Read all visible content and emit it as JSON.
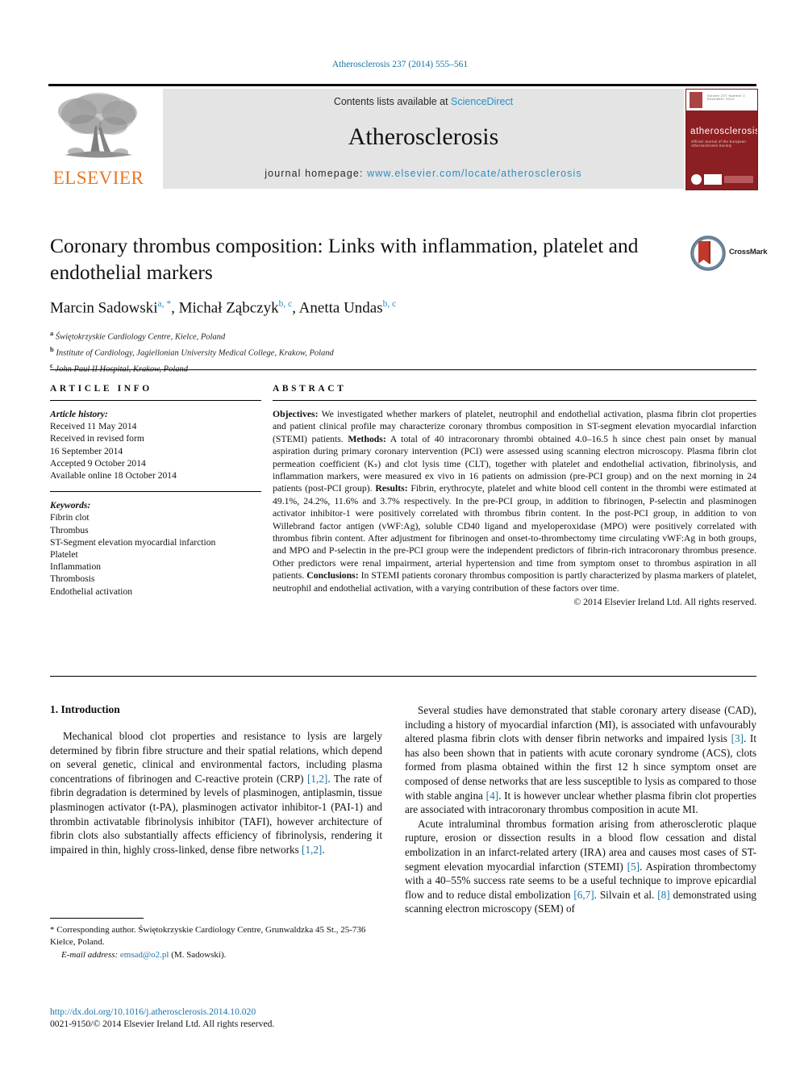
{
  "running_head": "Atherosclerosis 237 (2014) 555–561",
  "masthead": {
    "publisher": "ELSEVIER",
    "contents_prefix": "Contents lists available at ",
    "contents_link": "ScienceDirect",
    "journal_name": "Atherosclerosis",
    "homepage_prefix": "journal homepage: ",
    "homepage_url": "www.elsevier.com/locate/atherosclerosis",
    "cover": {
      "title": "atherosclerosis",
      "subtitle": "Official Journal of the European Atherosclerosis Society",
      "topline": "Volume 237  Number 2  December 2014"
    }
  },
  "article": {
    "title": "Coronary thrombus composition: Links with inflammation, platelet and endothelial markers",
    "authors": [
      {
        "name": "Marcin Sadowski",
        "marks": "a, *"
      },
      {
        "name": "Michał Ząbczyk",
        "marks": "b, c"
      },
      {
        "name": "Anetta Undas",
        "marks": "b, c"
      }
    ],
    "affiliations": [
      {
        "mark": "a",
        "text": "Świętokrzyskie Cardiology Centre, Kielce, Poland"
      },
      {
        "mark": "b",
        "text": "Institute of Cardiology, Jagiellonian University Medical College, Krakow, Poland"
      },
      {
        "mark": "c",
        "text": "John Paul II Hospital, Krakow, Poland"
      }
    ],
    "crossmark_label": "CrossMark"
  },
  "article_info": {
    "heading": "ARTICLE INFO",
    "history_label": "Article history:",
    "history": [
      "Received 11 May 2014",
      "Received in revised form",
      "16 September 2014",
      "Accepted 9 October 2014",
      "Available online 18 October 2014"
    ],
    "keywords_label": "Keywords:",
    "keywords": [
      "Fibrin clot",
      "Thrombus",
      "ST-Segment elevation myocardial infarction",
      "Platelet",
      "Inflammation",
      "Thrombosis",
      "Endothelial activation"
    ]
  },
  "abstract": {
    "heading": "ABSTRACT",
    "objectives_label": "Objectives:",
    "objectives_text": " We investigated whether markers of platelet, neutrophil and endothelial activation, plasma fibrin clot properties and patient clinical profile may characterize coronary thrombus composition in ST-segment elevation myocardial infarction (STEMI) patients. ",
    "methods_label": "Methods:",
    "methods_text": " A total of 40 intracoronary thrombi obtained 4.0–16.5 h since chest pain onset by manual aspiration during primary coronary intervention (PCI) were assessed using scanning electron microscopy. Plasma fibrin clot permeation coefficient (Kₛ) and clot lysis time (CLT), together with platelet and endothelial activation, fibrinolysis, and inflammation markers, were measured ex vivo in 16 patients on admission (pre-PCI group) and on the next morning in 24 patients (post-PCI group). ",
    "results_label": "Results:",
    "results_text": " Fibrin, erythrocyte, platelet and white blood cell content in the thrombi were estimated at 49.1%, 24.2%, 11.6% and 3.7% respectively. In the pre-PCI group, in addition to fibrinogen, P-selectin and plasminogen activator inhibitor-1 were positively correlated with thrombus fibrin content. In the post-PCI group, in addition to von Willebrand factor antigen (vWF:Ag), soluble CD40 ligand and myeloperoxidase (MPO) were positively correlated with thrombus fibrin content. After adjustment for fibrinogen and onset-to-thrombectomy time circulating vWF:Ag in both groups, and MPO and P-selectin in the pre-PCI group were the independent predictors of fibrin-rich intracoronary thrombus presence. Other predictors were renal impairment, arterial hypertension and time from symptom onset to thrombus aspiration in all patients. ",
    "conclusions_label": "Conclusions:",
    "conclusions_text": " In STEMI patients coronary thrombus composition is partly characterized by plasma markers of platelet, neutrophil and endothelial activation, with a varying contribution of these factors over time.",
    "copyright": "© 2014 Elsevier Ireland Ltd. All rights reserved."
  },
  "introduction": {
    "heading": "1. Introduction",
    "left_para_1a": "Mechanical blood clot properties and resistance to lysis are largely determined by fibrin fibre structure and their spatial relations, which depend on several genetic, clinical and environmental factors, including plasma concentrations of fibrinogen and C-reactive protein (CRP) ",
    "left_ref_1": "[1,2]",
    "left_para_1b": ". The rate of fibrin degradation is determined by levels of plasminogen, antiplasmin, tissue plasminogen activator (t-PA), plasminogen activator inhibitor-1 (PAI-1) and thrombin activatable fibrinolysis inhibitor (TAFI), however architecture of fibrin clots also substantially affects efficiency of fibrinolysis, rendering it impaired in thin, highly cross-linked, dense fibre networks ",
    "left_ref_2": "[1,2]",
    "left_para_1c": ".",
    "right_para_1a": "Several studies have demonstrated that stable coronary artery disease (CAD), including a history of myocardial infarction (MI), is associated with unfavourably altered plasma fibrin clots with denser fibrin networks and impaired lysis ",
    "right_ref_1": "[3]",
    "right_para_1b": ". It has also been shown that in patients with acute coronary syndrome (ACS), clots formed from plasma obtained within the first 12 h since symptom onset are composed of dense networks that are less susceptible to lysis as compared to those with stable angina ",
    "right_ref_2": "[4]",
    "right_para_1c": ". It is however unclear whether plasma fibrin clot properties are associated with intracoronary thrombus composition in acute MI.",
    "right_para_2a": "Acute intraluminal thrombus formation arising from atherosclerotic plaque rupture, erosion or dissection results in a blood flow cessation and distal embolization in an infarct-related artery (IRA) area and causes most cases of ST-segment elevation myocardial infarction (STEMI) ",
    "right_ref_3": "[5]",
    "right_para_2b": ". Aspiration thrombectomy with a 40–55% success rate seems to be a useful technique to improve epicardial flow and to reduce distal embolization ",
    "right_ref_4": "[6,7]",
    "right_para_2c": ". Silvain et al. ",
    "right_ref_5": "[8]",
    "right_para_2d": " demonstrated using scanning electron microscopy (SEM) of"
  },
  "footer": {
    "corresponding_star": "*",
    "corresponding_text": " Corresponding author. Świętokrzyskie Cardiology Centre, Grunwaldzka 45 St., 25-736 Kielce, Poland.",
    "email_label": "E-mail address:",
    "email": "emsad@o2.pl",
    "email_suffix": " (M. Sadowski).",
    "doi": "http://dx.doi.org/10.1016/j.atherosclerosis.2014.10.020",
    "issn": "0021-9150/© 2014 Elsevier Ireland Ltd. All rights reserved."
  },
  "colors": {
    "link": "#1a74a8",
    "elsevier_orange": "#E87722",
    "cover_red": "#8c1f22",
    "band_gray": "#e4e4e4"
  }
}
